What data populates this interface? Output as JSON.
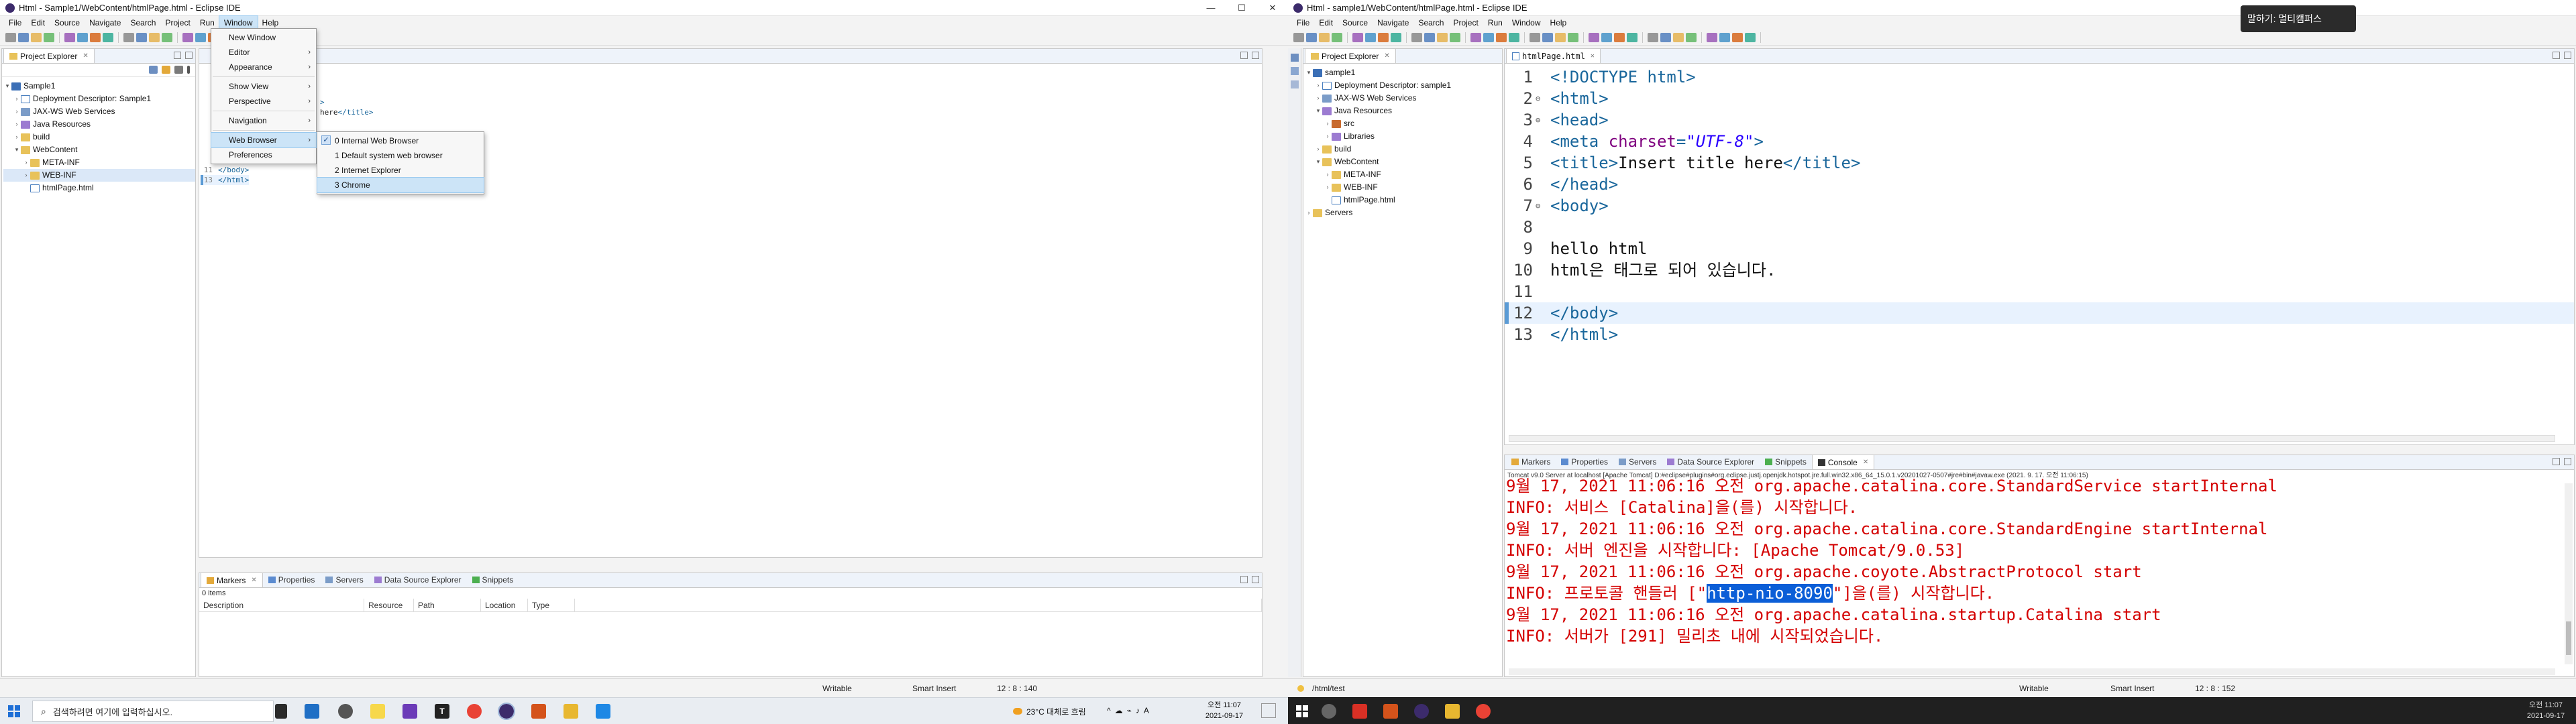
{
  "left": {
    "title": "Html - Sample1/WebContent/htmlPage.html - Eclipse IDE",
    "menu": [
      "File",
      "Edit",
      "Source",
      "Navigate",
      "Search",
      "Project",
      "Run",
      "Window",
      "Help"
    ],
    "explorer_tab": "Project Explorer",
    "tree": [
      {
        "label": "Sample1",
        "level": 0,
        "arrow": "▾",
        "icon": "proj"
      },
      {
        "label": "Deployment Descriptor: Sample1",
        "level": 1,
        "arrow": "›",
        "icon": "file"
      },
      {
        "label": "JAX-WS Web Services",
        "level": 1,
        "arrow": "›",
        "icon": "srv"
      },
      {
        "label": "Java Resources",
        "level": 1,
        "arrow": "›",
        "icon": "lib"
      },
      {
        "label": "build",
        "level": 1,
        "arrow": "›",
        "icon": "fold"
      },
      {
        "label": "WebContent",
        "level": 1,
        "arrow": "▾",
        "icon": "fold"
      },
      {
        "label": "META-INF",
        "level": 2,
        "arrow": "›",
        "icon": "fold"
      },
      {
        "label": "WEB-INF",
        "level": 2,
        "arrow": "›",
        "icon": "fold"
      },
      {
        "label": "htmlPage.html",
        "level": 2,
        "arrow": "",
        "icon": "file"
      }
    ],
    "editor_visible": [
      {
        "n": "",
        "t": ">"
      },
      {
        "n": "",
        "t": "here</title>"
      }
    ],
    "editor_lines": [
      {
        "n": "11",
        "t": "</body>"
      },
      {
        "n": "13",
        "t": "</html>"
      }
    ],
    "window_menu": {
      "items": [
        {
          "label": "New Window",
          "sub": false
        },
        {
          "label": "Editor",
          "sub": true
        },
        {
          "label": "Appearance",
          "sub": true
        },
        {
          "sep": true
        },
        {
          "label": "Show View",
          "sub": true
        },
        {
          "label": "Perspective",
          "sub": true
        },
        {
          "sep": true
        },
        {
          "label": "Navigation",
          "sub": true
        },
        {
          "sep": true
        },
        {
          "label": "Web Browser",
          "sub": true,
          "hover": true
        },
        {
          "label": "Preferences",
          "sub": false
        }
      ]
    },
    "browser_menu": {
      "items": [
        {
          "label": "0 Internal Web Browser",
          "checked": true
        },
        {
          "label": "1 Default system web browser",
          "checked": false
        },
        {
          "label": "2 Internet Explorer",
          "checked": false
        },
        {
          "label": "3 Chrome",
          "checked": false,
          "hover": true
        }
      ]
    },
    "bottom_tabs": [
      "Markers",
      "Properties",
      "Servers",
      "Data Source Explorer",
      "Snippets"
    ],
    "items_count": "0 items",
    "columns": [
      "Description",
      "Resource",
      "Path",
      "Location",
      "Type"
    ],
    "status": {
      "mode": "Writable",
      "insert": "Smart Insert",
      "pos": "12 : 8 : 140"
    }
  },
  "right": {
    "title": "Html - sample1/WebContent/htmlPage.html - Eclipse IDE",
    "menu": [
      "File",
      "Edit",
      "Source",
      "Navigate",
      "Search",
      "Project",
      "Run",
      "Window",
      "Help"
    ],
    "explorer_tab": "Project Explorer",
    "tree": [
      {
        "label": "sample1",
        "level": 0,
        "arrow": "▾",
        "icon": "proj"
      },
      {
        "label": "Deployment Descriptor: sample1",
        "level": 1,
        "arrow": "›",
        "icon": "file"
      },
      {
        "label": "JAX-WS Web Services",
        "level": 1,
        "arrow": "›",
        "icon": "srv"
      },
      {
        "label": "Java Resources",
        "level": 1,
        "arrow": "▾",
        "icon": "lib"
      },
      {
        "label": "src",
        "level": 2,
        "arrow": "›",
        "icon": "jar"
      },
      {
        "label": "Libraries",
        "level": 2,
        "arrow": "›",
        "icon": "lib"
      },
      {
        "label": "build",
        "level": 1,
        "arrow": "›",
        "icon": "fold"
      },
      {
        "label": "WebContent",
        "level": 1,
        "arrow": "▾",
        "icon": "fold"
      },
      {
        "label": "META-INF",
        "level": 2,
        "arrow": "›",
        "icon": "fold"
      },
      {
        "label": "WEB-INF",
        "level": 2,
        "arrow": "›",
        "icon": "fold"
      },
      {
        "label": "htmlPage.html",
        "level": 2,
        "arrow": "",
        "icon": "file"
      },
      {
        "label": "Servers",
        "level": 0,
        "arrow": "›",
        "icon": "fold"
      }
    ],
    "editor_tab": "htmlPage.html",
    "code": [
      {
        "n": "1",
        "mark": "",
        "parts": [
          [
            "tag",
            "<!DOCTYPE html>"
          ]
        ]
      },
      {
        "n": "2",
        "mark": "⊖",
        "parts": [
          [
            "tag",
            "<html>"
          ]
        ]
      },
      {
        "n": "3",
        "mark": "⊖",
        "parts": [
          [
            "tag",
            "<head>"
          ]
        ]
      },
      {
        "n": "4",
        "mark": "",
        "parts": [
          [
            "tag",
            "<meta "
          ],
          [
            "attr",
            "charset"
          ],
          [
            "tag",
            "="
          ],
          [
            "str",
            "\"UTF-8\""
          ],
          [
            "tag",
            ">"
          ]
        ]
      },
      {
        "n": "5",
        "mark": "",
        "parts": [
          [
            "tag",
            "<title>"
          ],
          [
            "txt",
            "Insert title here"
          ],
          [
            "tag",
            "</title>"
          ]
        ]
      },
      {
        "n": "6",
        "mark": "",
        "parts": [
          [
            "tag",
            "</head>"
          ]
        ]
      },
      {
        "n": "7",
        "mark": "⊖",
        "parts": [
          [
            "tag",
            "<body>"
          ]
        ]
      },
      {
        "n": "8",
        "mark": "",
        "parts": []
      },
      {
        "n": "9",
        "mark": "",
        "parts": [
          [
            "txt",
            "hello html"
          ]
        ]
      },
      {
        "n": "10",
        "mark": "",
        "parts": [
          [
            "txt",
            "html은 태그로 되어 있습니다."
          ]
        ]
      },
      {
        "n": "11",
        "mark": "",
        "parts": []
      },
      {
        "n": "12",
        "mark": "",
        "parts": [
          [
            "tag",
            "</body>"
          ]
        ]
      },
      {
        "n": "13",
        "mark": "",
        "parts": [
          [
            "tag",
            "</html>"
          ]
        ]
      }
    ],
    "bottom_tabs": [
      "Markers",
      "Properties",
      "Servers",
      "Data Source Explorer",
      "Snippets",
      "Console"
    ],
    "console_header": "Tomcat v9.0 Server at localhost [Apache Tomcat] D:#eclipse#plugins#org.eclipse.justj.openjdk.hotspot.jre.full.win32.x86_64_15.0.1.v20201027-0507#jre#bin#javaw.exe  (2021. 9. 17. 오전 11:06:15)",
    "console": [
      {
        "c": "red",
        "t": "9월 17, 2021 11:06:16 오전 org.apache.catalina.core.StandardService startInternal"
      },
      {
        "c": "red",
        "t": "INFO: 서비스 [Catalina]을(를) 시작합니다."
      },
      {
        "c": "red",
        "t": "9월 17, 2021 11:06:16 오전 org.apache.catalina.core.StandardEngine startInternal"
      },
      {
        "c": "red",
        "t": "INFO: 서버 엔진을 시작합니다: [Apache Tomcat/9.0.53]"
      },
      {
        "c": "red",
        "t": "9월 17, 2021 11:06:16 오전 org.apache.coyote.AbstractProtocol start"
      },
      {
        "c": "red",
        "t": "INFO: 프로토콜 핸들러 [\"",
        "sel": "http-nio-8090",
        "after": "\"]을(를) 시작합니다."
      },
      {
        "c": "red",
        "t": "9월 17, 2021 11:06:16 오전 org.apache.catalina.startup.Catalina start"
      },
      {
        "c": "red",
        "t": "INFO: 서버가 [291] 밀리초 내에 시작되었습니다."
      }
    ],
    "statusbar_left": "/html/test",
    "status": {
      "mode": "Writable",
      "insert": "Smart Insert",
      "pos": "12 : 8 : 152"
    },
    "toast": "말하기: 멀티캠퍼스"
  },
  "taskbar": {
    "search_placeholder": "검색하려면 여기에 입력하십시오.",
    "weather": "23°C 대체로 흐림",
    "ime": "A",
    "time": "오전 11:07",
    "date": "2021-09-17"
  },
  "colors": {
    "accent": "#0b5ed7",
    "console_red": "#d40000",
    "tag": "#19669b"
  }
}
